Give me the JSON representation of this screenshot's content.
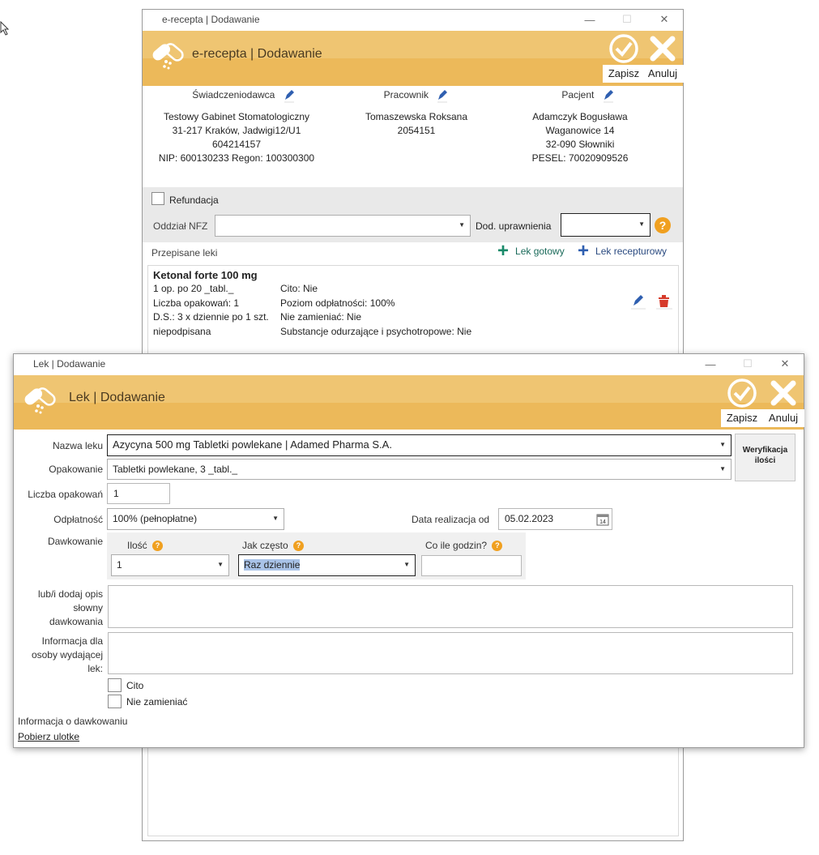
{
  "bg_window": {
    "title": "e-recepta | Dodawanie",
    "band_title": "e-recepta | Dodawanie",
    "save_label": "Zapisz",
    "cancel_label": "Anuluj",
    "provider": {
      "header": "Świadczeniodawca",
      "lines": [
        "Testowy Gabinet Stomatologiczny",
        "31-217 Kraków, Jadwigi12/U1",
        "604214157",
        "NIP: 600130233 Regon: 100300300"
      ]
    },
    "employee": {
      "header": "Pracownik",
      "lines": [
        "Tomaszewska Roksana",
        "2054151"
      ]
    },
    "patient": {
      "header": "Pacjent",
      "lines": [
        "Adamczyk Bogusława",
        "Waganowice 14",
        "32-090 Słowniki",
        "PESEL: 70020909526"
      ]
    },
    "refund_label": "Refundacja",
    "nfz_label": "Oddział NFZ",
    "nfz_value": "",
    "extra_rights_label": "Dod. uprawnienia",
    "extra_rights_value": "",
    "prescribed_label": "Przepisane leki",
    "add_ready_label": "Lek gotowy",
    "add_compound_label": "Lek recepturowy",
    "drug": {
      "name": "Ketonal forte 100 mg",
      "left": [
        "1 op. po 20 _tabl._",
        "Liczba opakowań: 1",
        "D.S.: 3 x dziennie po 1 szt.",
        "niepodpisana"
      ],
      "right": [
        "Cito: Nie",
        "Poziom odpłatności: 100%",
        "Nie zamieniać: Nie",
        "Substancje odurzające i psychotropowe: Nie"
      ]
    }
  },
  "fg_window": {
    "title": "Lek | Dodawanie",
    "band_title": "Lek | Dodawanie",
    "save_label": "Zapisz",
    "cancel_label": "Anuluj",
    "drug_name_label": "Nazwa leku",
    "drug_name_value": "Azycyna 500 mg Tabletki powlekane |  Adamed Pharma S.A.",
    "verify_label_1": "Weryfikacja",
    "verify_label_2": "ilości",
    "package_label": "Opakowanie",
    "package_value": "Tabletki powlekane, 3 _tabl._",
    "count_label": "Liczba opakowań",
    "count_value": "1",
    "payment_label": "Odpłatność",
    "payment_value": "100% (pełnopłatne)",
    "date_label": "Data realizacja od",
    "date_value": "05.02.2023",
    "calendar_day": "14",
    "dosage_label": "Dawkowanie",
    "qty_label": "Ilość",
    "qty_value": "1",
    "freq_label": "Jak często",
    "freq_value": "Raz dziennie",
    "hours_label": "Co ile godzin?",
    "hours_value": "",
    "desc_label_lines": [
      "lub/i dodaj opis",
      "słowny",
      "dawkowania"
    ],
    "info_label_lines": [
      "Informacja dla",
      "osoby wydającej",
      "lek:"
    ],
    "cito_label": "Cito",
    "no_substitute_label": "Nie zamieniać",
    "dosage_info_label": "Informacja o dawkowaniu",
    "leaflet_link": "Pobierz ulotke"
  },
  "colors": {
    "band": "#ecb95a",
    "band_light": "#efc572",
    "help": "#f0a020",
    "green_plus": "#1a8a6a",
    "blue_plus": "#2f5fb0",
    "delete_red": "#d63a2a",
    "selection": "#a9c3e8"
  },
  "icons": [
    "cursor-icon",
    "pills-logo-icon",
    "check-icon",
    "close-icon",
    "pencil-icon",
    "help-icon",
    "plus-icon",
    "trash-icon",
    "calendar-icon",
    "chevron-down-icon"
  ]
}
